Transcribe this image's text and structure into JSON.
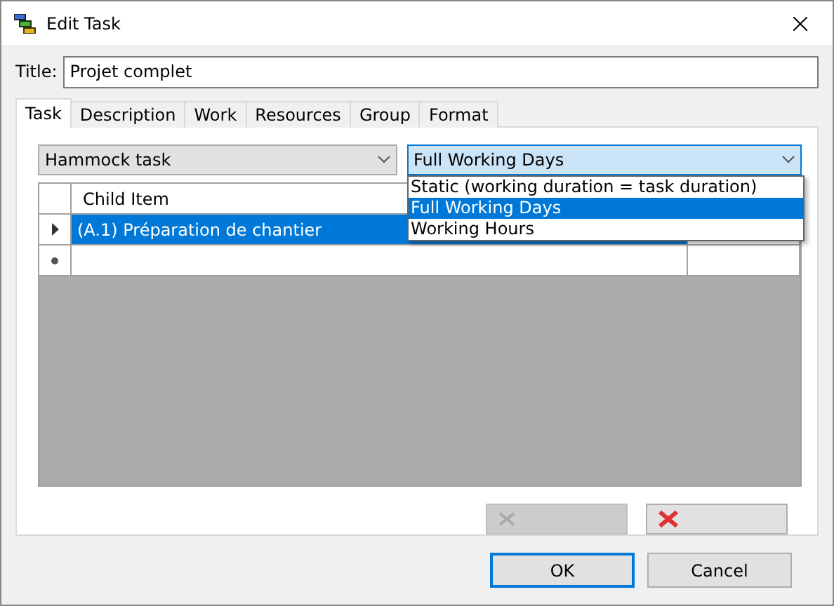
{
  "window": {
    "title": "Edit Task"
  },
  "title_field": {
    "label": "Title:",
    "value": "Projet complet"
  },
  "tabs": [
    {
      "label": "Task",
      "selected": true
    },
    {
      "label": "Description",
      "selected": false
    },
    {
      "label": "Work",
      "selected": false
    },
    {
      "label": "Resources",
      "selected": false
    },
    {
      "label": "Group",
      "selected": false
    },
    {
      "label": "Format",
      "selected": false
    }
  ],
  "task_type": {
    "value": "Hammock task"
  },
  "duration_mode": {
    "value": "Full Working Days",
    "expanded": true,
    "options": [
      {
        "label": "Static (working duration = task duration)",
        "selected": false
      },
      {
        "label": "Full Working Days",
        "selected": true
      },
      {
        "label": "Working Hours",
        "selected": false
      }
    ]
  },
  "grid": {
    "columns": [
      "Child Item"
    ],
    "rows": [
      {
        "child_item": "(A.1) Préparation de chantier",
        "selected": true
      }
    ]
  },
  "panel_buttons": [
    {
      "kind": "delete",
      "disabled": true
    },
    {
      "kind": "clear",
      "disabled": false
    }
  ],
  "buttons": [
    {
      "label": "OK",
      "default": true
    },
    {
      "label": "Cancel",
      "default": false
    }
  ]
}
